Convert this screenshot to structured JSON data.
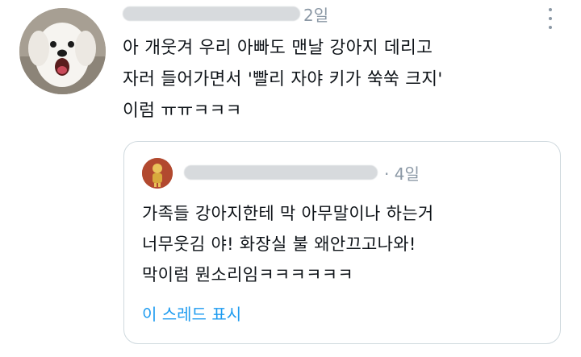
{
  "tweet": {
    "time": "2일",
    "text_lines": [
      "아 개웃겨 우리 아빠도 맨날 강아지 데리고",
      "자러 들어가면서 '빨리 자야 키가 쑥쑥 크지'",
      "이럼 ㅠㅠㅋㅋㅋ"
    ],
    "avatar_icon": "white-dog-photo",
    "more_icon": "more-vertical-icon"
  },
  "quote": {
    "time": "· 4일",
    "text_lines": [
      "가족들 강아지한테 막 아무말이나 하는거",
      "너무웃김 야! 화장실 불 왜안끄고나와!",
      "막이럼 뭔소리임ㅋㅋㅋㅋㅋㅋ"
    ],
    "show_thread": "이 스레드 표시",
    "avatar_icon": "character-avatar"
  },
  "colors": {
    "text": "#0f1419",
    "secondary": "#8b98a5",
    "link": "#1d9bf0",
    "border": "#cfd9de"
  }
}
